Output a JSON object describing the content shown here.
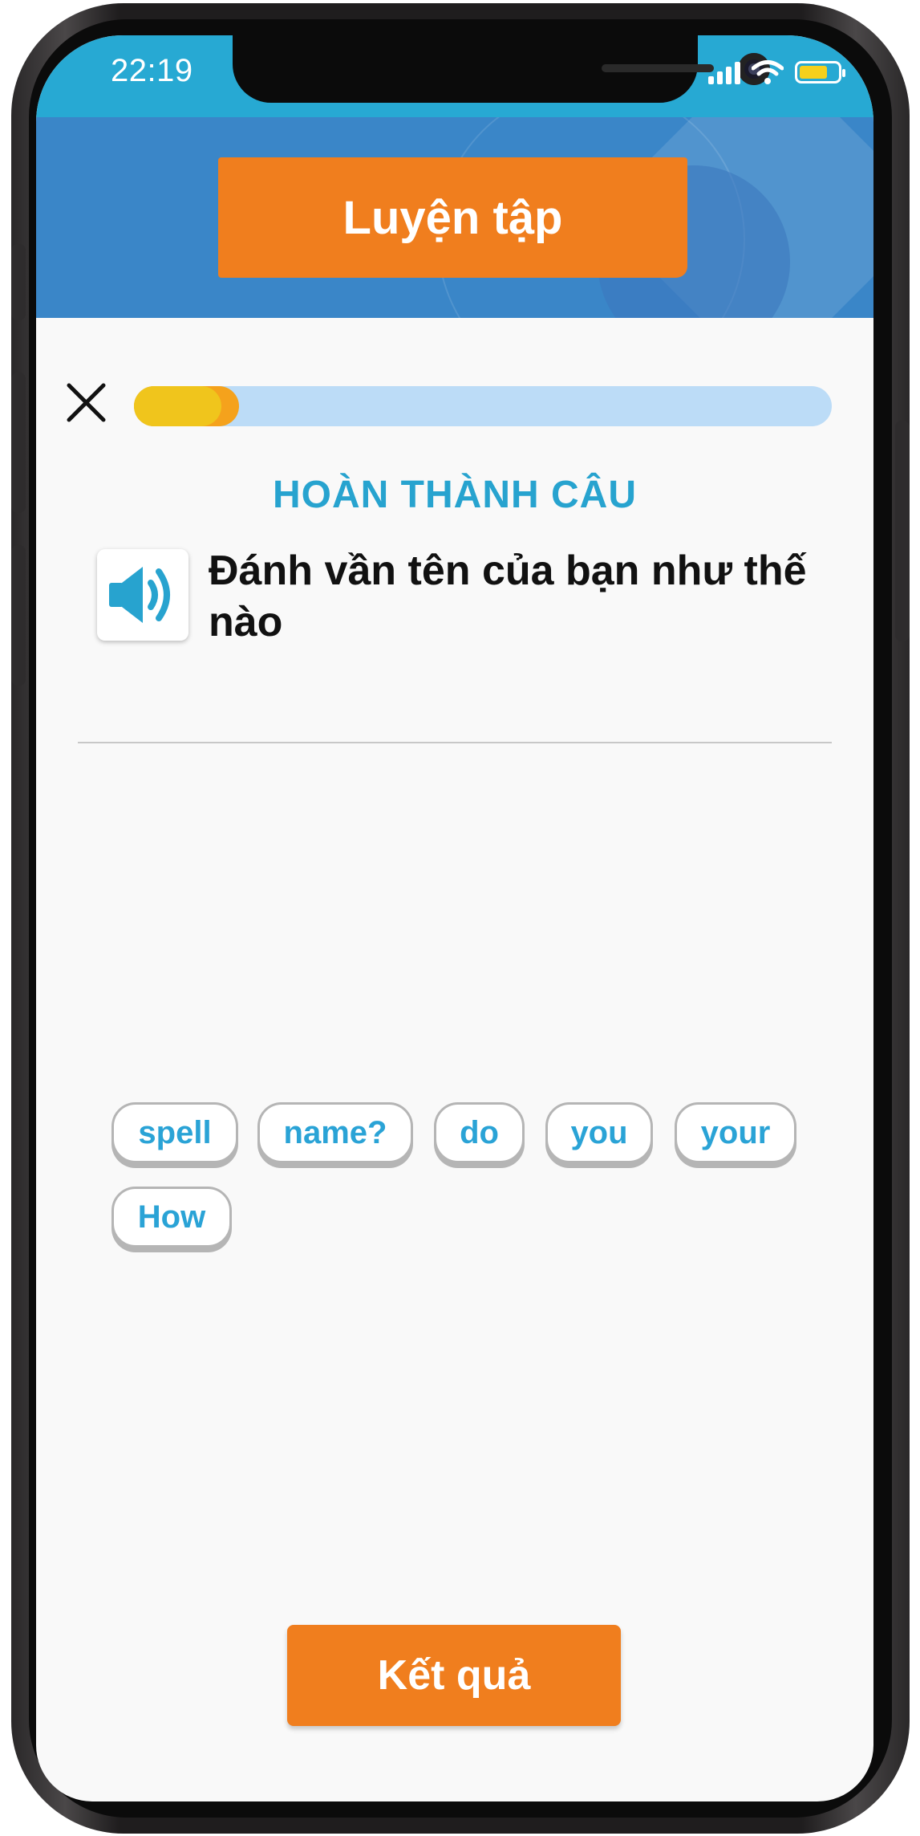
{
  "status_bar": {
    "time": "22:19",
    "icons": [
      "cellular-signal-icon",
      "wifi-icon",
      "battery-icon"
    ]
  },
  "header": {
    "title": "Luyện tập"
  },
  "progress": {
    "fraction": 0.15
  },
  "exercise": {
    "section_title": "HOÀN THÀNH CÂU",
    "question": "Đánh vần tên của bạn như thế nào",
    "audio_icon": "speaker-icon"
  },
  "word_bank": {
    "words": [
      "spell",
      "name?",
      "do",
      "you",
      "your",
      "How"
    ]
  },
  "footer": {
    "result_label": "Kết quả"
  },
  "colors": {
    "accent_orange": "#f07e1e",
    "header_blue": "#3a86c8",
    "status_blue": "#27a9d3",
    "word_text": "#2aa3d6",
    "progress_track": "#bcdcf7",
    "progress_fill": "#f0c51c"
  }
}
